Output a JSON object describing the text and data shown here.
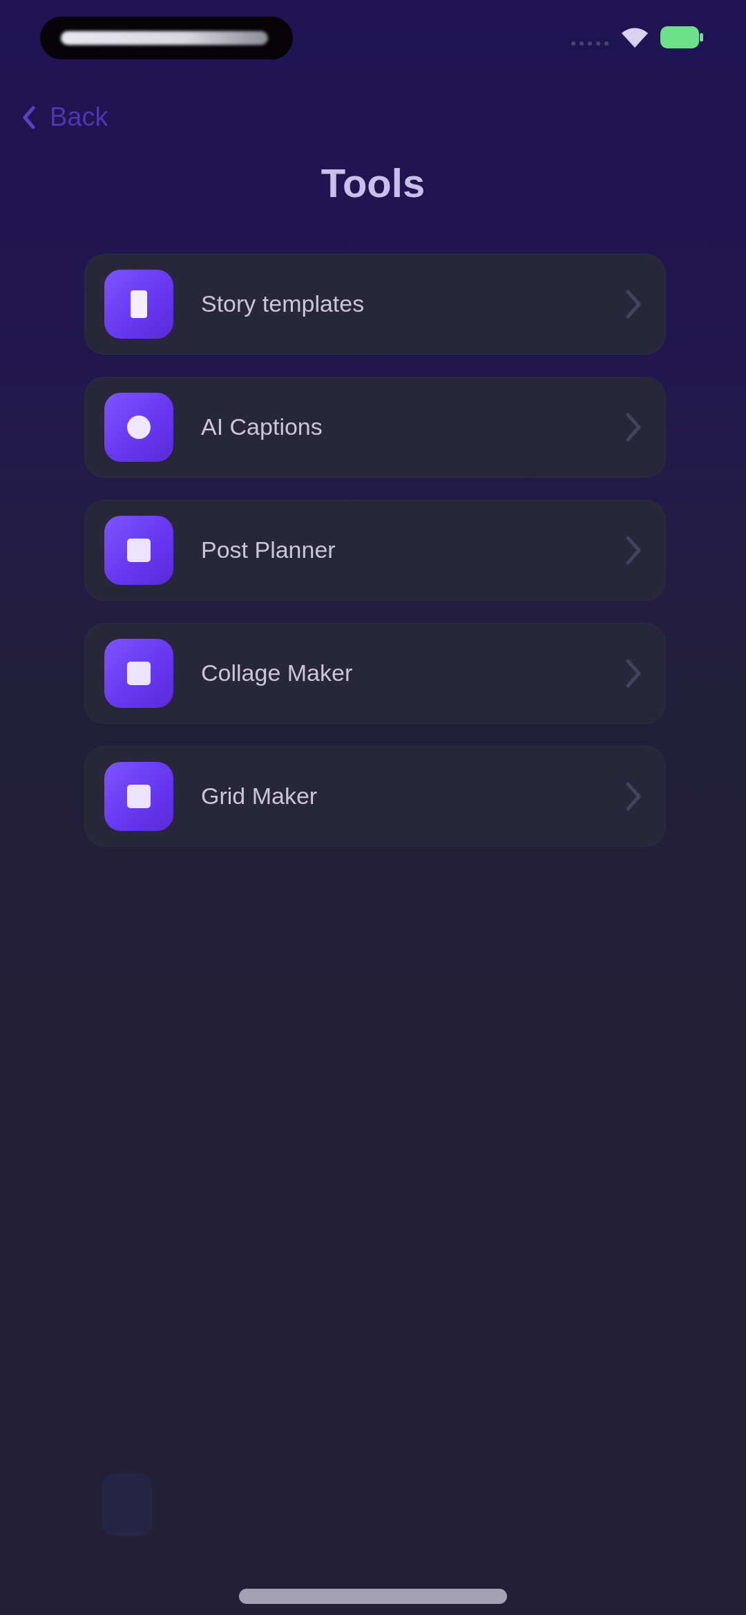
{
  "nav": {
    "back_label": "Back",
    "title": "Tools"
  },
  "tools": [
    {
      "label": "Story templates",
      "kind": "story"
    },
    {
      "label": "AI Captions",
      "kind": "captions"
    },
    {
      "label": "Post Planner",
      "kind": "planner"
    },
    {
      "label": "Collage Maker",
      "kind": "collage"
    },
    {
      "label": "Grid Maker",
      "kind": "grid"
    }
  ]
}
